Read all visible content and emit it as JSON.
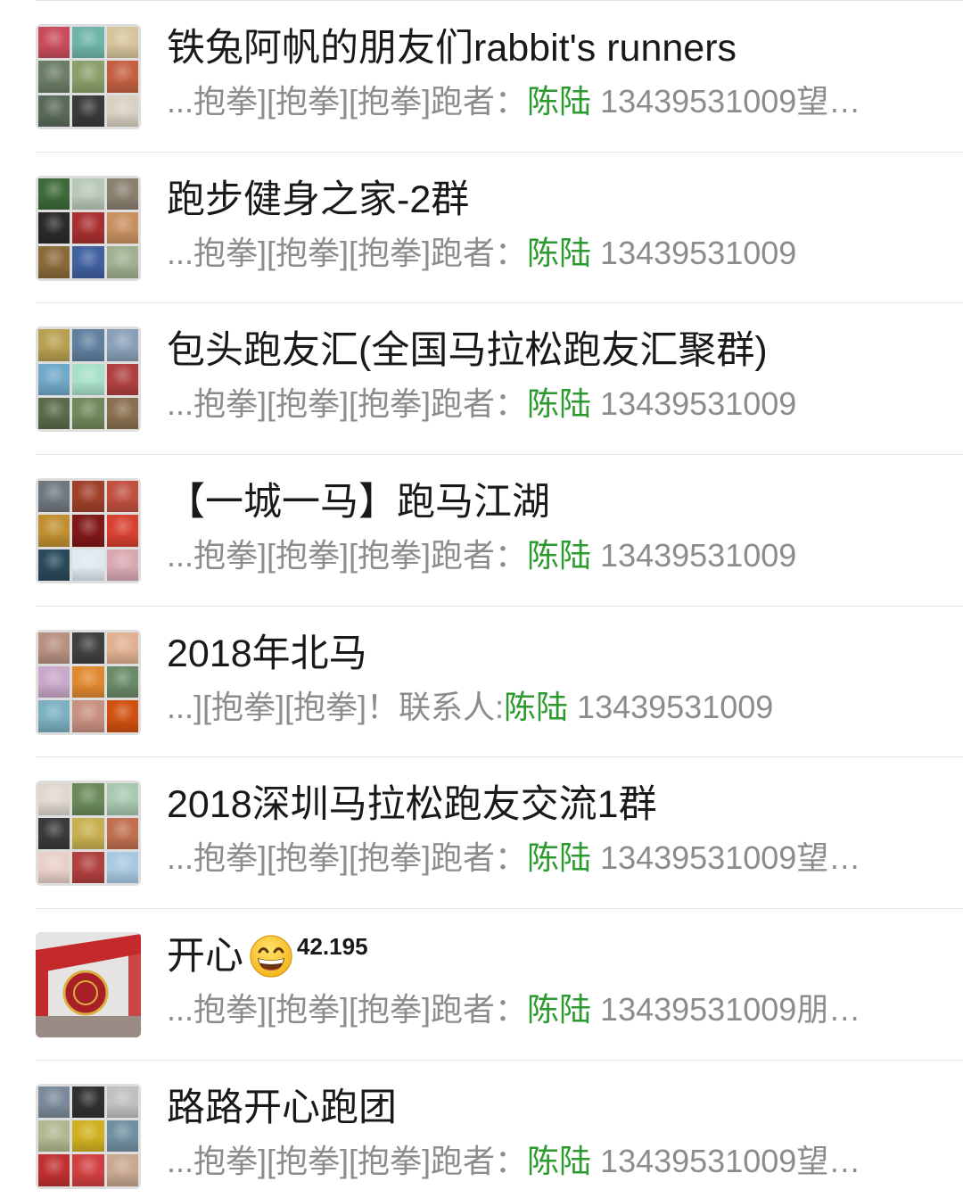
{
  "colors": {
    "background": "#ffffff",
    "title": "#191919",
    "snippet": "#8c8c8c",
    "highlight": "#2c9a2e",
    "separator": "#e5e5e5",
    "avatar_bg": "#dedede"
  },
  "rows": [
    {
      "title": "铁兔阿帆的朋友们rabbit's runners",
      "snippet_prefix": "...抱拳][抱拳][抱拳]跑者：",
      "snippet_highlight": "陈陆",
      "snippet_suffix": " 13439531009望…",
      "avatar_tiles": [
        "#c94c5c",
        "#6fb4a8",
        "#d6c49c",
        "#6b7d66",
        "#8aa06a",
        "#c46040",
        "#5a6a5a",
        "#3a3a3a",
        "#d8d0c0"
      ]
    },
    {
      "title": "跑步健身之家-2群",
      "snippet_prefix": "...抱拳][抱拳][抱拳]跑者：",
      "snippet_highlight": "陈陆",
      "snippet_suffix": " 13439531009",
      "avatar_tiles": [
        "#3d6a3a",
        "#b8c8b8",
        "#8a8070",
        "#2a2a2a",
        "#a83030",
        "#c89060",
        "#8a6a3a",
        "#4060a0",
        "#a0b090"
      ]
    },
    {
      "title": "包头跑友汇(全国马拉松跑友汇聚群)",
      "snippet_prefix": "...抱拳][抱拳][抱拳]跑者：",
      "snippet_highlight": "陈陆",
      "snippet_suffix": " 13439531009",
      "avatar_tiles": [
        "#b8a050",
        "#6080a0",
        "#8aa0b8",
        "#70a8c8",
        "#a8e0c8",
        "#b04040",
        "#5a6a4a",
        "#70885a",
        "#8a7050"
      ]
    },
    {
      "title": "【一城一马】跑马江湖",
      "snippet_prefix": "...抱拳][抱拳][抱拳]跑者：",
      "snippet_highlight": "陈陆",
      "snippet_suffix": " 13439531009",
      "avatar_tiles": [
        "#707880",
        "#a0402a",
        "#c05040",
        "#c09030",
        "#801818",
        "#d84030",
        "#2a4a5a",
        "#e0e8f0",
        "#d8a8b0"
      ]
    },
    {
      "title": "2018年北马",
      "snippet_prefix": "...][抱拳][抱拳]！联系人:",
      "snippet_highlight": "陈陆",
      "snippet_suffix": " 13439531009",
      "avatar_tiles": [
        "#b89080",
        "#404040",
        "#e0b090",
        "#c8a8c8",
        "#e08830",
        "#6a8a6a",
        "#7ab0c0",
        "#c89080",
        "#d05010"
      ]
    },
    {
      "title": "2018深圳马拉松跑友交流1群",
      "snippet_prefix": "...抱拳][抱拳][抱拳]跑者：",
      "snippet_highlight": "陈陆",
      "snippet_suffix": " 13439531009望…",
      "avatar_tiles": [
        "#e0d8d0",
        "#6a8a5a",
        "#a8c8b0",
        "#3a3a3a",
        "#c8b050",
        "#c07050",
        "#e8d0c8",
        "#b04040",
        "#a8c8e0"
      ]
    },
    {
      "title": "开心",
      "title_emoji": "grinning-face-icon",
      "title_sup": "42.195",
      "snippet_prefix": "...抱拳][抱拳][抱拳]跑者：",
      "snippet_highlight": "陈陆",
      "snippet_suffix": " 13439531009朋…",
      "avatar_photo": {
        "background": "#e6e4e2",
        "arch": "#c42a2c",
        "emblem": "#a81f28",
        "emblem_ring": "#d8b040",
        "ground": "#9a8c84"
      }
    },
    {
      "title": "路路开心跑团",
      "snippet_prefix": "...抱拳][抱拳][抱拳]跑者：",
      "snippet_highlight": "陈陆",
      "snippet_suffix": " 13439531009望…",
      "avatar_tiles": [
        "#7a8a9a",
        "#303030",
        "#c0c0c0",
        "#b0b890",
        "#d0b020",
        "#7090a0",
        "#c03030",
        "#d04040",
        "#c8a890"
      ]
    }
  ]
}
